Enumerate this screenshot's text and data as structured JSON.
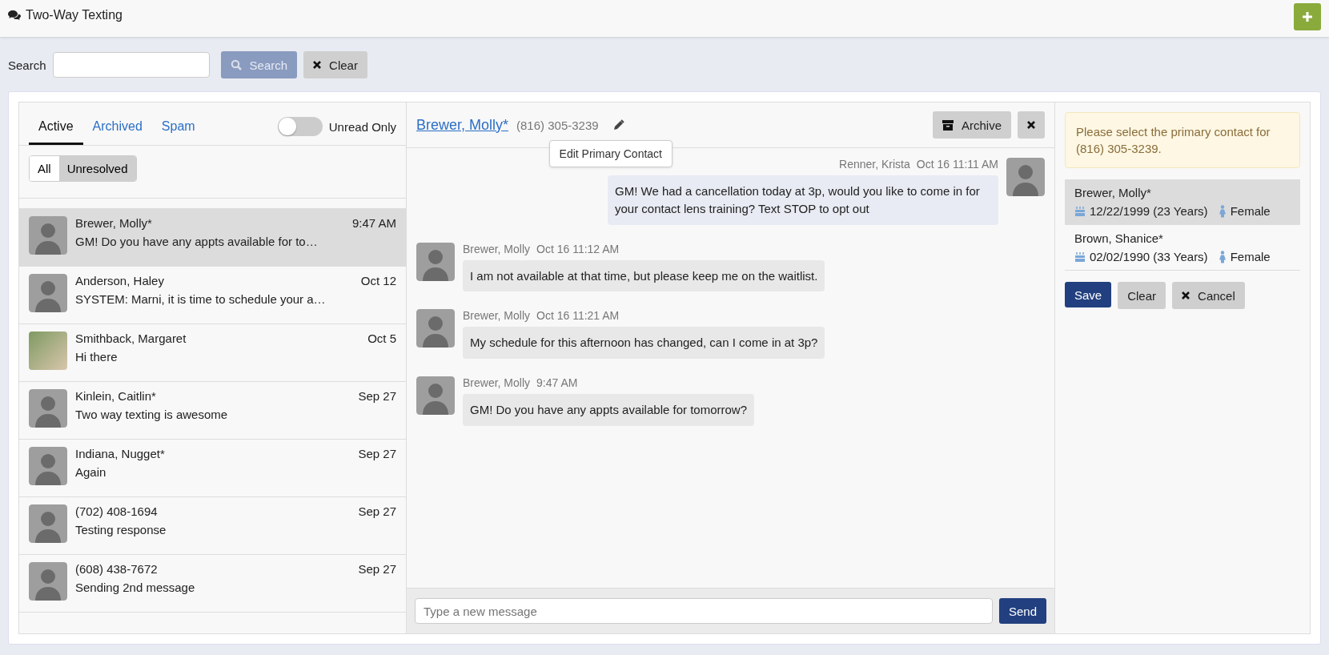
{
  "header": {
    "title": "Two-Way Texting"
  },
  "search": {
    "label": "Search",
    "search_button": "Search",
    "clear_button": "Clear"
  },
  "tabs": [
    {
      "label": "Active",
      "selected": true
    },
    {
      "label": "Archived",
      "selected": false
    },
    {
      "label": "Spam",
      "selected": false
    }
  ],
  "unread_toggle": {
    "label": "Unread Only",
    "on": false
  },
  "filter": [
    {
      "label": "All",
      "selected": false
    },
    {
      "label": "Unresolved",
      "selected": true
    }
  ],
  "conversations": [
    {
      "name": "Brewer, Molly*",
      "time": "9:47 AM",
      "preview": "GM! Do you have any appts available for to…",
      "kind": "placeholder",
      "selected": true
    },
    {
      "name": "Anderson, Haley",
      "time": "Oct 12",
      "preview": "SYSTEM: Marni, it is time to schedule your a…",
      "kind": "placeholder",
      "selected": false
    },
    {
      "name": "Smithback, Margaret",
      "time": "Oct 5",
      "preview": "Hi there",
      "kind": "photo",
      "selected": false
    },
    {
      "name": "Kinlein, Caitlin*",
      "time": "Sep 27",
      "preview": "Two way texting is awesome",
      "kind": "placeholder",
      "selected": false
    },
    {
      "name": "Indiana, Nugget*",
      "time": "Sep 27",
      "preview": "Again",
      "kind": "placeholder",
      "selected": false
    },
    {
      "name": "(702) 408-1694",
      "time": "Sep 27",
      "preview": "Testing response",
      "kind": "placeholder",
      "selected": false
    },
    {
      "name": "(608) 438-7672",
      "time": "Sep 27",
      "preview": "Sending 2nd message",
      "kind": "placeholder",
      "selected": false
    }
  ],
  "chat": {
    "contact": "Brewer, Molly*",
    "phone": "(816) 305-3239",
    "tooltip": "Edit Primary Contact",
    "archive_button": "Archive",
    "messages": [
      {
        "kind": "outgoing",
        "sender": "Renner, Krista",
        "time": "Oct 16 11:11 AM",
        "text": "GM! We had a cancellation today at 3p, would you like to come in for your contact lens training? Text STOP to opt out"
      },
      {
        "kind": "incoming",
        "sender": "Brewer, Molly",
        "time": "Oct 16 11:12 AM",
        "text": "I am not available at that time, but please keep me on the waitlist."
      },
      {
        "kind": "incoming",
        "sender": "Brewer, Molly",
        "time": "Oct 16 11:21 AM",
        "text": "My schedule for this afternoon has changed, can I come in at 3p?"
      },
      {
        "kind": "incoming",
        "sender": "Brewer, Molly",
        "time": "9:47 AM",
        "text": "GM! Do you have any appts available for tomorrow?"
      }
    ],
    "input_placeholder": "Type a new message",
    "send_button": "Send"
  },
  "primary_contact": {
    "notice": "Please select the primary contact for (816) 305-3239.",
    "contacts": [
      {
        "name": "Brewer, Molly*",
        "birthdate": "12/22/1999 (23 Years)",
        "gender": "Female",
        "selected": true
      },
      {
        "name": "Brown, Shanice*",
        "birthdate": "02/02/1990 (33 Years)",
        "gender": "Female",
        "selected": false
      }
    ],
    "save_button": "Save",
    "clear_button": "Clear",
    "cancel_button": "Cancel"
  }
}
